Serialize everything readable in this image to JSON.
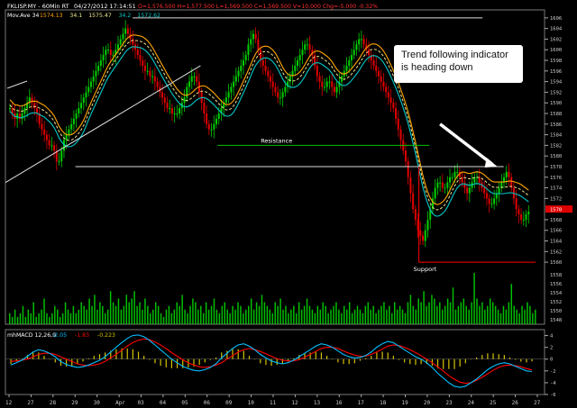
{
  "header": {
    "symbol": "FKLISP.MY - 60Min RT",
    "datetime": "04/27/2012 17:14:51",
    "ohlc": "O=1,576.500  H=1,577.500  L=1,569.500  C=1,569.500  V=10,000  Chg=-5.000  -0.32%",
    "ma_label": "Mov.Ave 34",
    "ma_values": [
      "1574.13",
      "34.1",
      "1575.47",
      "34.2",
      "1572.62"
    ]
  },
  "macd_header": {
    "label": "mhMACD 12,26,9",
    "values": [
      "-2.05",
      "-1.83",
      "-0.223"
    ]
  },
  "annotations": {
    "callout": "Trend following indicator is heading down",
    "resistance": "Resistance",
    "support": "Support",
    "last_price_tag": "1570"
  },
  "colors": {
    "up_candle": "#00d000",
    "down_candle": "#e00000",
    "ma_orange": "#ffa500",
    "ma_yellow": "#f0e68c",
    "ma_cyan": "#00c8c8",
    "resistance_line": "#00c000",
    "support_line": "#ff0000",
    "macd_line": "#00bfff",
    "signal_line": "#ff0000",
    "hist": "#d4c200",
    "volume": "#00c000"
  },
  "chart_data": [
    {
      "type": "candlestick",
      "y_ticks": [
        1606,
        1604,
        1602,
        1600,
        1598,
        1596,
        1594,
        1592,
        1590,
        1588,
        1586,
        1584,
        1582,
        1580,
        1578,
        1576,
        1574,
        1572,
        1568,
        1566,
        1564,
        1562,
        1560
      ],
      "ylim": [
        1559,
        1607.5
      ],
      "x_tick_labels": [
        "12",
        "27",
        "28",
        "29",
        "30",
        "Apr",
        "03",
        "04",
        "05",
        "06",
        "09",
        "10",
        "11",
        "12",
        "13",
        "16",
        "17",
        "18",
        "19",
        "20",
        "23",
        "24",
        "25",
        "26",
        "27"
      ],
      "x_range": [
        0,
        250
      ],
      "series_close": [
        1589,
        1588,
        1587,
        1588,
        1587,
        1588,
        1589,
        1590,
        1591,
        1590,
        1589,
        1588,
        1586,
        1585,
        1584,
        1583,
        1582,
        1582,
        1581,
        1579,
        1579,
        1581,
        1583,
        1584,
        1585,
        1586,
        1587,
        1588,
        1589,
        1590,
        1591,
        1592,
        1593,
        1594,
        1595,
        1596,
        1597,
        1598,
        1599,
        1600,
        1600,
        1599,
        1599,
        1600,
        1601,
        1602,
        1603,
        1604,
        1603,
        1602,
        1601,
        1600,
        1599,
        1598,
        1597,
        1596,
        1596,
        1595,
        1595,
        1594,
        1593,
        1592,
        1591,
        1590,
        1589,
        1589,
        1588,
        1588,
        1588,
        1589,
        1590,
        1591,
        1593,
        1594,
        1595,
        1595,
        1594,
        1592,
        1590,
        1588,
        1586,
        1585,
        1585,
        1586,
        1587,
        1588,
        1589,
        1590,
        1591,
        1592,
        1593,
        1594,
        1595,
        1596,
        1597,
        1598,
        1599,
        1601,
        1602,
        1603,
        1602,
        1600,
        1598,
        1597,
        1596,
        1595,
        1594,
        1593,
        1592,
        1591,
        1591,
        1592,
        1593,
        1594,
        1595,
        1596,
        1597,
        1598,
        1599,
        1600,
        1601,
        1601,
        1600,
        1599,
        1597,
        1595,
        1594,
        1593,
        1593,
        1594,
        1594,
        1593,
        1592,
        1593,
        1594,
        1595,
        1596,
        1597,
        1598,
        1599,
        1600,
        1601,
        1602,
        1602,
        1601,
        1600,
        1599,
        1598,
        1597,
        1596,
        1595,
        1594,
        1593,
        1592,
        1591,
        1590,
        1589,
        1587,
        1585,
        1583,
        1581,
        1579,
        1576,
        1573,
        1570,
        1568,
        1566,
        1565,
        1564,
        1566,
        1568,
        1570,
        1572,
        1574,
        1575,
        1575,
        1574,
        1574,
        1575,
        1576,
        1576,
        1577,
        1577,
        1576,
        1575,
        1574,
        1573,
        1574,
        1575,
        1576,
        1576,
        1575,
        1574,
        1573,
        1572,
        1571,
        1571,
        1572,
        1573,
        1574,
        1575,
        1576,
        1577,
        1576,
        1574,
        1572,
        1570,
        1569,
        1568,
        1568,
        1569,
        1569.5
      ],
      "moving_averages": [
        "orange",
        "yellow-dashed",
        "cyan"
      ],
      "resistance": {
        "y": 1582,
        "x": [
          100,
          200
        ],
        "label": "Resistance"
      },
      "ceiling_line": {
        "y": 1606,
        "x": [
          60,
          225
        ]
      },
      "horizontal_line_1578": {
        "y": 1578,
        "x": [
          33,
          235
        ]
      },
      "support": {
        "y": 1560,
        "x": [
          195,
          250
        ],
        "label": "Support"
      },
      "trendline": {
        "from": [
          0,
          1575
        ],
        "to": [
          92,
          1597
        ]
      },
      "down_arrow": {
        "from": [
          205,
          1586
        ],
        "to": [
          232,
          1578
        ]
      },
      "last_price": 1570
    },
    {
      "type": "bar",
      "name": "Volume",
      "y_ticks": [
        1558,
        1556,
        1554,
        1552,
        1550,
        1548
      ],
      "values": [
        3,
        2,
        4,
        2,
        3,
        5,
        2,
        4,
        3,
        6,
        2,
        3,
        4,
        7,
        3,
        2,
        3,
        5,
        4,
        2,
        3,
        6,
        4,
        3,
        5,
        3,
        4,
        6,
        5,
        4,
        7,
        5,
        8,
        4,
        6,
        5,
        3,
        4,
        9,
        6,
        5,
        7,
        4,
        5,
        8,
        6,
        7,
        9,
        5,
        6,
        4,
        7,
        5,
        3,
        4,
        6,
        5,
        3,
        2,
        4,
        5,
        3,
        4,
        6,
        5,
        8,
        4,
        3,
        5,
        7,
        6,
        4,
        5,
        3,
        6,
        4,
        5,
        7,
        4,
        3,
        5,
        6,
        4,
        3,
        5,
        4,
        6,
        5,
        3,
        4,
        5,
        7,
        4,
        6,
        5,
        8,
        6,
        5,
        4,
        3,
        6,
        5,
        7,
        4,
        5,
        3,
        4,
        5,
        3,
        6,
        4,
        5,
        7,
        5,
        4,
        3,
        5,
        4,
        6,
        5,
        3,
        4,
        5,
        6,
        4,
        3,
        5,
        4,
        6,
        3,
        4,
        5,
        4,
        3,
        5,
        6,
        4,
        5,
        3,
        4,
        5,
        6,
        4,
        5,
        3,
        6,
        4,
        5,
        4,
        3,
        6,
        8,
        5,
        4,
        7,
        6,
        9,
        5,
        6,
        8,
        7,
        5,
        6,
        4,
        5,
        7,
        6,
        10,
        4,
        5,
        6,
        7,
        5,
        4,
        6,
        14,
        7,
        5,
        6,
        4,
        5,
        7,
        6,
        5,
        4,
        3,
        5,
        4,
        6,
        11,
        5,
        4,
        3,
        5,
        4,
        6,
        5,
        3,
        4
      ]
    },
    {
      "type": "line",
      "name": "MACD",
      "y_ticks": [
        4,
        2,
        0,
        -2,
        -4,
        -6
      ],
      "ylim": [
        -6,
        5
      ],
      "series": [
        {
          "name": "macd",
          "values": [
            -1,
            -0.6,
            -0.2,
            0.5,
            1.2,
            1.6,
            1.4,
            1.0,
            0.4,
            -0.4,
            -0.9,
            -1.2,
            -1.4,
            -1.3,
            -1.0,
            -0.6,
            -0.2,
            0.4,
            1.2,
            2.0,
            2.8,
            3.5,
            4.0,
            4.1,
            3.8,
            3.2,
            2.4,
            1.6,
            0.8,
            0.0,
            -0.6,
            -1.2,
            -1.6,
            -1.9,
            -2.0,
            -1.8,
            -1.4,
            -0.8,
            0.2,
            1.0,
            1.8,
            2.4,
            2.6,
            2.2,
            1.6,
            0.8,
            0.2,
            -0.3,
            -0.6,
            -0.8,
            -0.6,
            -0.2,
            0.4,
            1.0,
            1.6,
            2.2,
            2.6,
            2.4,
            2.0,
            1.4,
            0.8,
            0.4,
            0.2,
            0.3,
            0.6,
            1.2,
            2.0,
            2.6,
            3.0,
            2.8,
            2.2,
            1.6,
            1.0,
            0.4,
            0.0,
            -0.6,
            -1.4,
            -2.4,
            -3.2,
            -4.0,
            -4.6,
            -4.8,
            -4.6,
            -4.0,
            -3.4,
            -2.6,
            -1.8,
            -1.2,
            -0.8,
            -0.6,
            -0.8,
            -1.2,
            -1.6,
            -2.0,
            -2.1
          ]
        },
        {
          "name": "signal",
          "values": [
            -0.4,
            -0.3,
            -0.2,
            0.0,
            0.4,
            0.8,
            1.0,
            1.0,
            0.8,
            0.4,
            0.0,
            -0.4,
            -0.8,
            -1.0,
            -1.1,
            -1.0,
            -0.8,
            -0.4,
            0.2,
            0.8,
            1.5,
            2.2,
            2.8,
            3.2,
            3.4,
            3.3,
            2.9,
            2.4,
            1.8,
            1.1,
            0.5,
            -0.1,
            -0.6,
            -1.0,
            -1.3,
            -1.4,
            -1.3,
            -1.0,
            -0.6,
            0.0,
            0.6,
            1.2,
            1.6,
            1.8,
            1.6,
            1.3,
            0.9,
            0.5,
            0.1,
            -0.2,
            -0.3,
            -0.3,
            -0.1,
            0.3,
            0.8,
            1.3,
            1.8,
            2.0,
            2.0,
            1.8,
            1.4,
            1.0,
            0.7,
            0.5,
            0.5,
            0.8,
            1.2,
            1.7,
            2.2,
            2.4,
            2.3,
            2.0,
            1.6,
            1.1,
            0.6,
            0.0,
            -0.6,
            -1.3,
            -2.0,
            -2.8,
            -3.4,
            -3.9,
            -4.1,
            -4.0,
            -3.6,
            -3.1,
            -2.5,
            -1.9,
            -1.4,
            -1.1,
            -1.0,
            -1.1,
            -1.3,
            -1.6,
            -1.83
          ]
        }
      ]
    }
  ]
}
